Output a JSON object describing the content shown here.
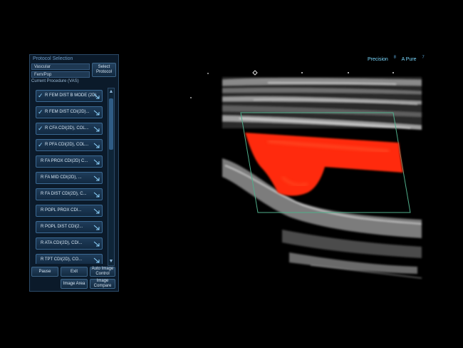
{
  "panel": {
    "title": "Protocol Selection",
    "field1": "Vascular",
    "field2": "Fem/Pop",
    "select_button": "Select Protocol",
    "current_label": "Current Procedure (VAS)",
    "items": [
      {
        "label": "R FEM DIST B MODE (2D)",
        "checked": true
      },
      {
        "label": "R FEM DIST CDI(2D)...",
        "checked": true
      },
      {
        "label": "R CFA CDI(2D), COL...",
        "checked": true
      },
      {
        "label": "R PFA CDI(2D), COL...",
        "checked": true
      },
      {
        "label": "R FA PROX CDI(2D) C...",
        "checked": false
      },
      {
        "label": "R FA MID CDI(2D), ...",
        "checked": false
      },
      {
        "label": "R FA DIST CDI(2D), C...",
        "checked": false
      },
      {
        "label": "R POPL PROX CDI...",
        "checked": false
      },
      {
        "label": "R POPL DIST CDI(2...",
        "checked": false
      },
      {
        "label": "R ATA CDI(2D), CDI...",
        "checked": false
      },
      {
        "label": "R TPT CDI(2D), CO...",
        "checked": false
      }
    ],
    "buttons": {
      "pause": "Pause",
      "exit": "Exit",
      "auto_image_control": "Auto Image Control",
      "image_area": "Image Area",
      "image_compare": "Image Compare"
    }
  },
  "top_labels": {
    "precision": "Precision",
    "precision_val": "8",
    "apure": "A Pure",
    "apure_val": "7"
  },
  "colors": {
    "flow_red": "#ff2a0a",
    "panel_bg": "#0b1a2a",
    "accent": "#5fb1e6"
  }
}
